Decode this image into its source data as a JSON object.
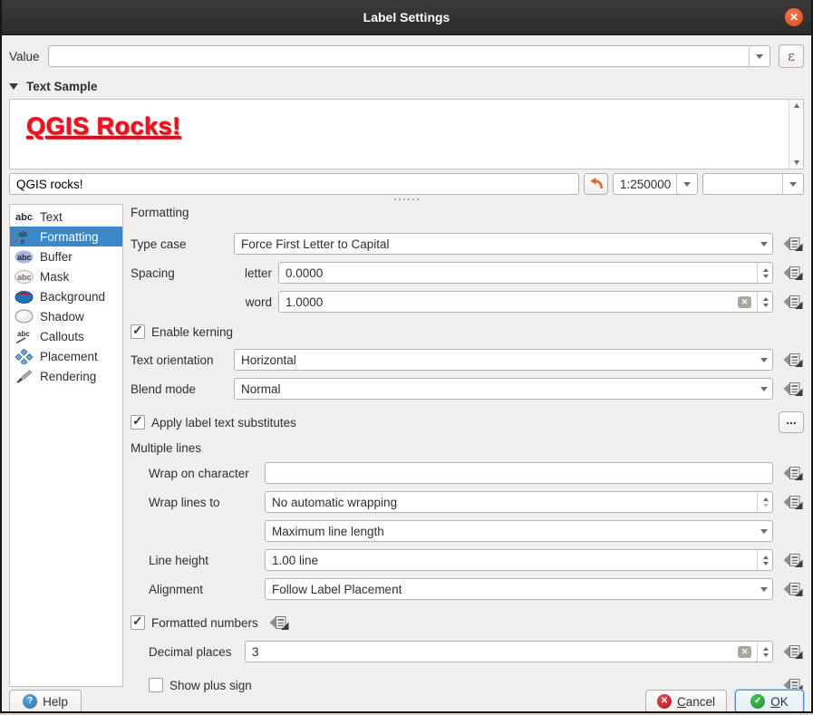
{
  "window": {
    "title": "Label Settings"
  },
  "value_row": {
    "label": "Value",
    "value": "",
    "epsilon_label": "ε"
  },
  "text_sample": {
    "header": "Text Sample",
    "preview_text": "QGIS Rocks!",
    "sample_input": "QGIS rocks!",
    "scale_value": "1:250000",
    "font_size_value": ""
  },
  "sidebar": {
    "selected": "Formatting",
    "items": [
      {
        "label": "Text",
        "icon": "text-icon"
      },
      {
        "label": "Formatting",
        "icon": "formatting-icon"
      },
      {
        "label": "Buffer",
        "icon": "buffer-icon"
      },
      {
        "label": "Mask",
        "icon": "mask-icon"
      },
      {
        "label": "Background",
        "icon": "background-icon"
      },
      {
        "label": "Shadow",
        "icon": "shadow-icon"
      },
      {
        "label": "Callouts",
        "icon": "callouts-icon"
      },
      {
        "label": "Placement",
        "icon": "placement-icon"
      },
      {
        "label": "Rendering",
        "icon": "rendering-icon"
      }
    ]
  },
  "panel": {
    "header": "Formatting",
    "type_case": {
      "label": "Type case",
      "value": "Force First Letter to Capital"
    },
    "spacing": {
      "label": "Spacing",
      "letter_label": "letter",
      "letter_value": "0.0000",
      "word_label": "word",
      "word_value": "1.0000"
    },
    "enable_kerning": {
      "label": "Enable kerning",
      "checked": true
    },
    "text_orientation": {
      "label": "Text orientation",
      "value": "Horizontal"
    },
    "blend_mode": {
      "label": "Blend mode",
      "value": "Normal"
    },
    "apply_substitutes": {
      "label": "Apply label text substitutes",
      "checked": true,
      "more_label": "..."
    },
    "multiple_lines": {
      "header": "Multiple lines",
      "wrap_on_character": {
        "label": "Wrap on character",
        "value": ""
      },
      "wrap_lines_to": {
        "label": "Wrap lines to",
        "value": "No automatic wrapping"
      },
      "wrap_mode": {
        "value": "Maximum line length"
      },
      "line_height": {
        "label": "Line height",
        "value": "1.00 line"
      },
      "alignment": {
        "label": "Alignment",
        "value": "Follow Label Placement"
      }
    },
    "formatted_numbers": {
      "label": "Formatted numbers",
      "checked": true
    },
    "decimal_places": {
      "label": "Decimal places",
      "value": "3"
    },
    "show_plus_sign": {
      "label": "Show plus sign",
      "checked": false
    }
  },
  "footer": {
    "help_label": "Help",
    "cancel_label": "Cancel",
    "ok_label": "OK"
  },
  "colors": {
    "titlebar": "#32312f",
    "close_button": "#e0491f",
    "selection_blue": "#3a87c9",
    "preview_text_red": "#ee1220",
    "epsilon_purple": "#7d3f87",
    "undo_orange": "#e2672f",
    "ok_green": "#1f9230",
    "cancel_red": "#b5131f",
    "help_blue": "#2b74b5"
  }
}
